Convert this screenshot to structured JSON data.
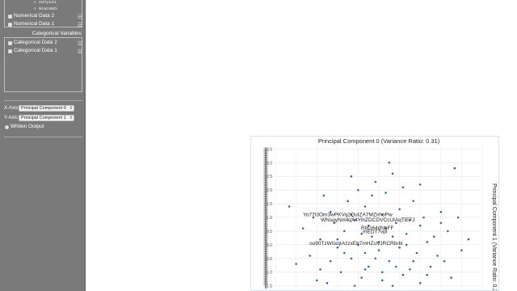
{
  "sidebar": {
    "numerical_variables": {
      "sub_items": [
        {
          "label": "mlZTy1rel1"
        },
        {
          "label": "IkGaO4kEb"
        }
      ],
      "items": [
        {
          "label": "Numerical Data 2",
          "checked": true
        },
        {
          "label": "Numerical Data 1",
          "checked": true
        }
      ]
    },
    "categorical_variables": {
      "title": "Categorical Variables",
      "items": [
        {
          "label": "Categorical Data 2",
          "checked": false
        },
        {
          "label": "Categorical Data 1",
          "checked": false
        }
      ]
    },
    "controls": {
      "x_axis_label": "X-Axis",
      "x_axis_value": "Principal Component 0",
      "y_axis_label": "Y-Axis",
      "y_axis_value": "Principal Component 1",
      "whiten_label": "Whiten Output",
      "whiten_checked": false
    },
    "menu_icon": "hamburger-menu-icon"
  },
  "chart_data": {
    "type": "scatter",
    "title": "Principal Component 0 (Variance Ratio: 0.31)",
    "ylabel": "Principal Component 1 (Variance Ratio: 0.27)",
    "xlabel": "",
    "ylim": [
      -1.5,
      3.5
    ],
    "yticks": [
      "3.5",
      "3.0",
      "2.5",
      "2.0",
      "1.5",
      "1.0",
      "0.5",
      "0.0",
      "-0.5",
      "-1.0",
      "-1.5"
    ],
    "grid": true,
    "point_color": "#2f6fa8",
    "annotations": [
      {
        "text": "Yo77I3Om3wPKVq2QuIZA7MZnhoPw",
        "x": 0.1,
        "y": 0.95
      },
      {
        "text": "WNsqyNnl4qX4YihZDCDVCcUIAqTiEFJ",
        "x": 0.55,
        "y": 0.85
      },
      {
        "text": "RbG64dNbFF",
        "x": 0.35,
        "y": 0.55
      },
      {
        "text": "mEDT7vpl",
        "x": 0.35,
        "y": 0.45
      },
      {
        "text": "ou90TzWIixqIAzzxEb7mHZuVJRCRbrbl",
        "x": 0.2,
        "y": 0.0
      }
    ],
    "points": [
      [
        -0.6,
        1.2
      ],
      [
        0.1,
        0.9
      ],
      [
        0.4,
        1.4
      ],
      [
        0.9,
        1.1
      ],
      [
        1.3,
        0.8
      ],
      [
        -0.2,
        0.5
      ],
      [
        0.6,
        0.3
      ],
      [
        1.0,
        0.6
      ],
      [
        1.6,
        0.4
      ],
      [
        2.0,
        0.7
      ],
      [
        -0.9,
        0.2
      ],
      [
        -0.4,
        -0.1
      ],
      [
        0.2,
        0.0
      ],
      [
        0.8,
        -0.2
      ],
      [
        1.4,
        -0.1
      ],
      [
        2.2,
        0.1
      ],
      [
        -1.2,
        -0.4
      ],
      [
        -0.6,
        -0.6
      ],
      [
        0.0,
        -0.5
      ],
      [
        0.5,
        -0.8
      ],
      [
        1.1,
        -0.6
      ],
      [
        1.7,
        -0.9
      ],
      [
        2.5,
        -0.4
      ],
      [
        -0.3,
        -1.0
      ],
      [
        0.3,
        -1.2
      ],
      [
        0.9,
        -1.3
      ],
      [
        1.5,
        -1.1
      ],
      [
        -1.0,
        -1.3
      ],
      [
        2.8,
        0.5
      ],
      [
        3.2,
        -0.2
      ],
      [
        0.7,
        2.3
      ],
      [
        1.2,
        2.6
      ],
      [
        0.2,
        2.0
      ],
      [
        1.8,
        1.6
      ],
      [
        -0.8,
        1.8
      ],
      [
        2.6,
        1.2
      ],
      [
        -1.4,
        0.6
      ],
      [
        3.0,
        2.8
      ],
      [
        1.1,
        3.0
      ],
      [
        0.4,
        -0.3
      ],
      [
        1.9,
        -0.3
      ],
      [
        2.3,
        -0.8
      ],
      [
        -0.1,
        1.6
      ],
      [
        0.6,
        1.8
      ],
      [
        1.4,
        1.3
      ],
      [
        2.1,
        1.0
      ],
      [
        -0.5,
        0.8
      ],
      [
        0.0,
        1.1
      ],
      [
        1.6,
        0.0
      ],
      [
        2.7,
        -0.6
      ],
      [
        -1.6,
        -0.7
      ],
      [
        -0.7,
        -1.4
      ],
      [
        0.1,
        -1.5
      ],
      [
        1.2,
        -1.5
      ],
      [
        2.0,
        -1.4
      ],
      [
        2.9,
        -1.2
      ],
      [
        3.4,
        0.2
      ],
      [
        -1.8,
        1.4
      ],
      [
        0.5,
        0.7
      ],
      [
        1.0,
        1.9
      ],
      [
        1.5,
        2.1
      ],
      [
        0.8,
        0.1
      ],
      [
        1.2,
        0.3
      ],
      [
        0.3,
        0.4
      ],
      [
        -0.2,
        -0.3
      ],
      [
        2.4,
        0.3
      ],
      [
        1.8,
        -0.6
      ],
      [
        0.7,
        -0.5
      ],
      [
        -0.9,
        -0.9
      ],
      [
        2.2,
        -1.1
      ],
      [
        0.0,
        2.5
      ],
      [
        2.0,
        2.2
      ],
      [
        -1.1,
        1.0
      ],
      [
        3.1,
        1.0
      ],
      [
        0.9,
        -1.0
      ],
      [
        1.3,
        -0.8
      ],
      [
        0.4,
        -0.9
      ],
      [
        -0.4,
        0.2
      ],
      [
        1.7,
        0.9
      ],
      [
        2.6,
        0.8
      ]
    ],
    "axis_stack_count": 60
  }
}
